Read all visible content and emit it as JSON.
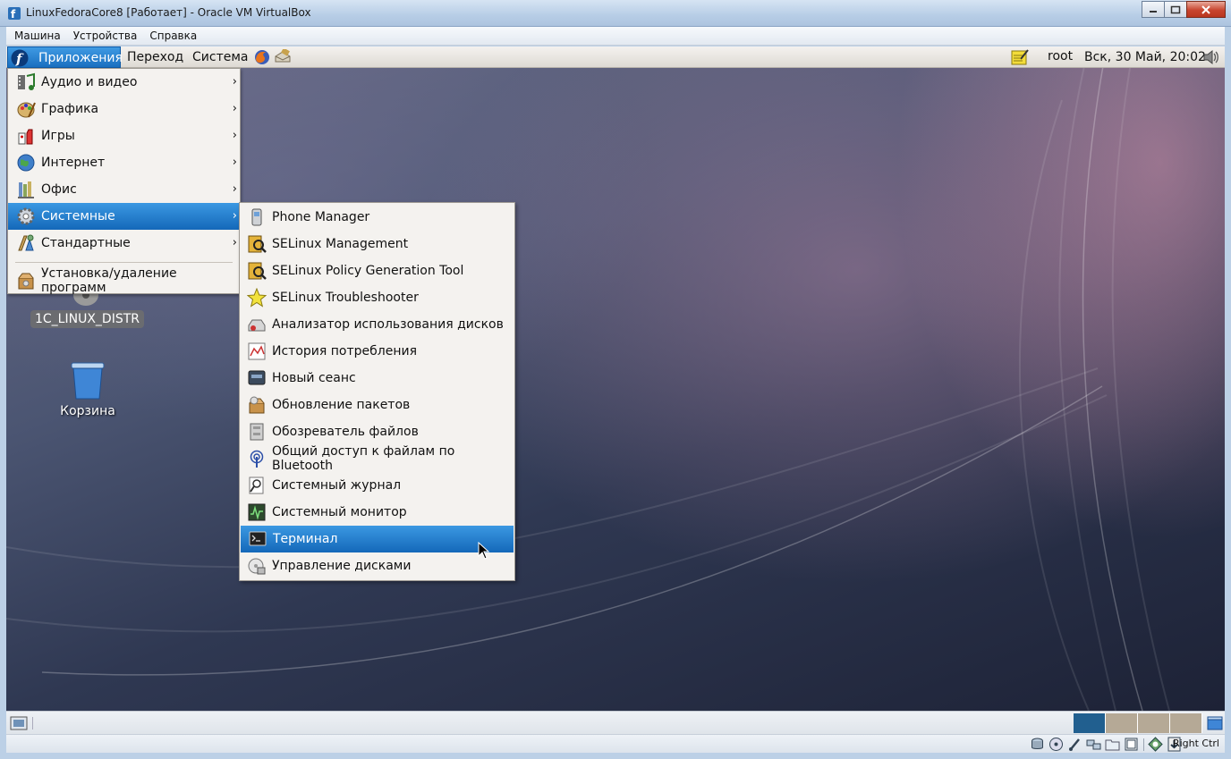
{
  "window": {
    "title": "LinuxFedoraCore8 [Работает] - Oracle VM VirtualBox",
    "accent": "#b7cde6"
  },
  "vbox_menu": {
    "items": [
      "Машина",
      "Устройства",
      "Справка"
    ]
  },
  "panel": {
    "applications": "Приложения",
    "places": "Переход",
    "system": "Система",
    "user": "root",
    "clock": "Вск, 30 Май, 20:02"
  },
  "apps_menu": {
    "items": [
      {
        "label": "Аудио и видео",
        "icon": "multimedia-icon",
        "submenu": true
      },
      {
        "label": "Графика",
        "icon": "graphics-icon",
        "submenu": true
      },
      {
        "label": "Игры",
        "icon": "games-icon",
        "submenu": true
      },
      {
        "label": "Интернет",
        "icon": "internet-icon",
        "submenu": true
      },
      {
        "label": "Офис",
        "icon": "office-icon",
        "submenu": true
      },
      {
        "label": "Системные",
        "icon": "system-tools-icon",
        "submenu": true,
        "active": true
      },
      {
        "label": "Стандартные",
        "icon": "accessories-icon",
        "submenu": true
      }
    ],
    "extra": "Установка/удаление программ",
    "arrow": "›"
  },
  "system_submenu": {
    "items": [
      {
        "label": "Phone Manager",
        "icon": "phone-icon"
      },
      {
        "label": "SELinux Management",
        "icon": "selinux-icon"
      },
      {
        "label": "SELinux Policy Generation Tool",
        "icon": "selinux-policy-icon"
      },
      {
        "label": "SELinux Troubleshooter",
        "icon": "star-icon"
      },
      {
        "label": "Анализатор использования дисков",
        "icon": "disk-usage-icon"
      },
      {
        "label": "История потребления",
        "icon": "chart-icon"
      },
      {
        "label": "Новый сеанс",
        "icon": "monitor-icon"
      },
      {
        "label": "Обновление пакетов",
        "icon": "package-update-icon"
      },
      {
        "label": "Обозреватель файлов",
        "icon": "file-cabinet-icon"
      },
      {
        "label": "Общий доступ к файлам по Bluetooth",
        "icon": "bluetooth-icon"
      },
      {
        "label": "Системный журнал",
        "icon": "log-viewer-icon"
      },
      {
        "label": "Системный монитор",
        "icon": "system-monitor-icon"
      },
      {
        "label": "Терминал",
        "icon": "terminal-icon",
        "active": true
      },
      {
        "label": "Управление дисками",
        "icon": "disk-manager-icon"
      }
    ]
  },
  "desktop": {
    "cd_label": "1C_LINUX_DISTR",
    "trash_label": "Корзина"
  },
  "statusbar": {
    "hostkey": "Right Ctrl"
  }
}
